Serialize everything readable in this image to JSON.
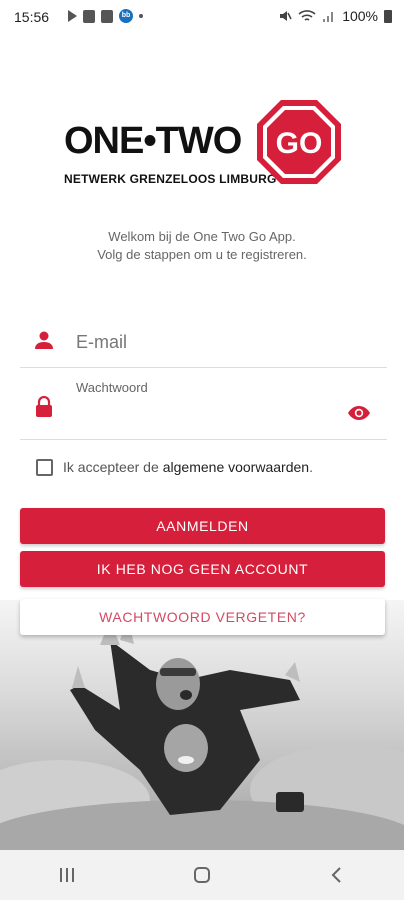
{
  "status_bar": {
    "time": "15:56",
    "left_icons": [
      "play-store-icon",
      "gallery-icon",
      "check-icon",
      "bb-icon",
      "dot-icon"
    ],
    "right_icons": [
      "mute-icon",
      "wifi-icon",
      "signal-icon"
    ],
    "battery": "100%"
  },
  "logo": {
    "main_text": "ONE•TWO",
    "octagon_text": "GO",
    "subtitle": "NETWERK GRENZELOOS LIMBURG"
  },
  "welcome": {
    "line1": "Welkom bij de One Two Go App.",
    "line2": "Volg de stappen om u te registreren."
  },
  "form": {
    "email_placeholder": "E-mail",
    "password_label": "Wachtwoord",
    "password_value": ""
  },
  "terms": {
    "prefix": "Ik accepteer de",
    "link": "algemene voorwaarden",
    "suffix": "."
  },
  "buttons": {
    "login": "AANMELDEN",
    "register": "IK HEB NOG GEEN ACCOUNT",
    "forgot": "WACHTWOORD VERGETEN?"
  },
  "colors": {
    "brand_red": "#d61f3a",
    "link_red": "#d24b63"
  },
  "nav": [
    "recent-apps-icon",
    "home-icon",
    "back-icon"
  ]
}
